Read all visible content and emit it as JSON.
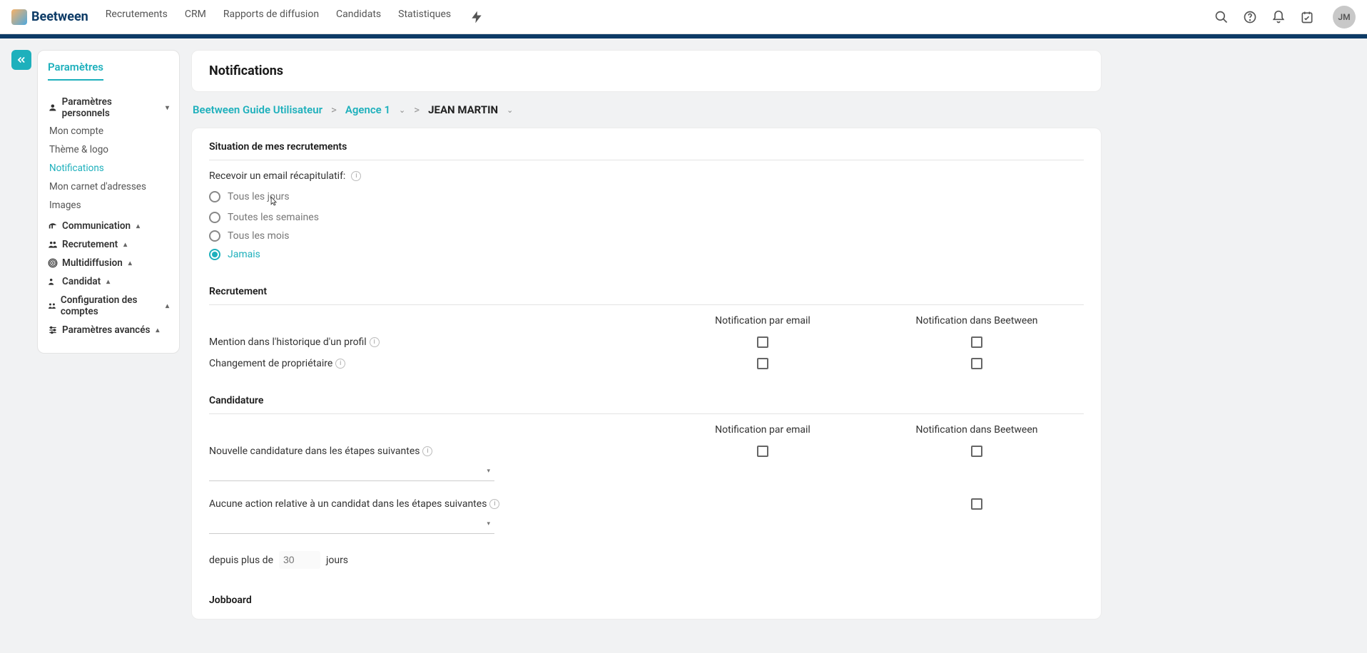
{
  "brand": "Beetween",
  "nav": {
    "items": [
      "Recrutements",
      "CRM",
      "Rapports de diffusion",
      "Candidats",
      "Statistiques"
    ]
  },
  "avatar": "JM",
  "sidebar": {
    "title": "Paramètres",
    "groups": {
      "personal": {
        "label": "Paramètres personnels",
        "items": [
          "Mon compte",
          "Thème & logo",
          "Notifications",
          "Mon carnet d'adresses",
          "Images"
        ],
        "active_index": 2
      },
      "communication": {
        "label": "Communication"
      },
      "recrutement": {
        "label": "Recrutement"
      },
      "multidiffusion": {
        "label": "Multidiffusion"
      },
      "candidat": {
        "label": "Candidat"
      },
      "config": {
        "label": "Configuration des comptes"
      },
      "avances": {
        "label": "Paramètres avancés"
      }
    }
  },
  "page": {
    "title": "Notifications"
  },
  "breadcrumb": {
    "root": "Beetween Guide Utilisateur",
    "agency": "Agence 1",
    "user": "JEAN MARTIN"
  },
  "situation": {
    "heading": "Situation de mes recrutements",
    "recap_label": "Recevoir un email récapitulatif:",
    "options": [
      "Tous les jours",
      "Toutes les semaines",
      "Tous les mois",
      "Jamais"
    ],
    "selected_index": 3
  },
  "recrutement": {
    "heading": "Recrutement",
    "col_email": "Notification par email",
    "col_app": "Notification dans Beetween",
    "rows": [
      {
        "label": "Mention dans l'historique d'un profil"
      },
      {
        "label": "Changement de propriétaire"
      }
    ]
  },
  "candidature": {
    "heading": "Candidature",
    "col_email": "Notification par email",
    "col_app": "Notification dans Beetween",
    "row1": "Nouvelle candidature dans les étapes suivantes",
    "row2": "Aucune action relative à un candidat dans les étapes suivantes",
    "since_prefix": "depuis plus de",
    "since_value": "30",
    "since_suffix": "jours"
  },
  "jobboard": {
    "heading": "Jobboard"
  }
}
